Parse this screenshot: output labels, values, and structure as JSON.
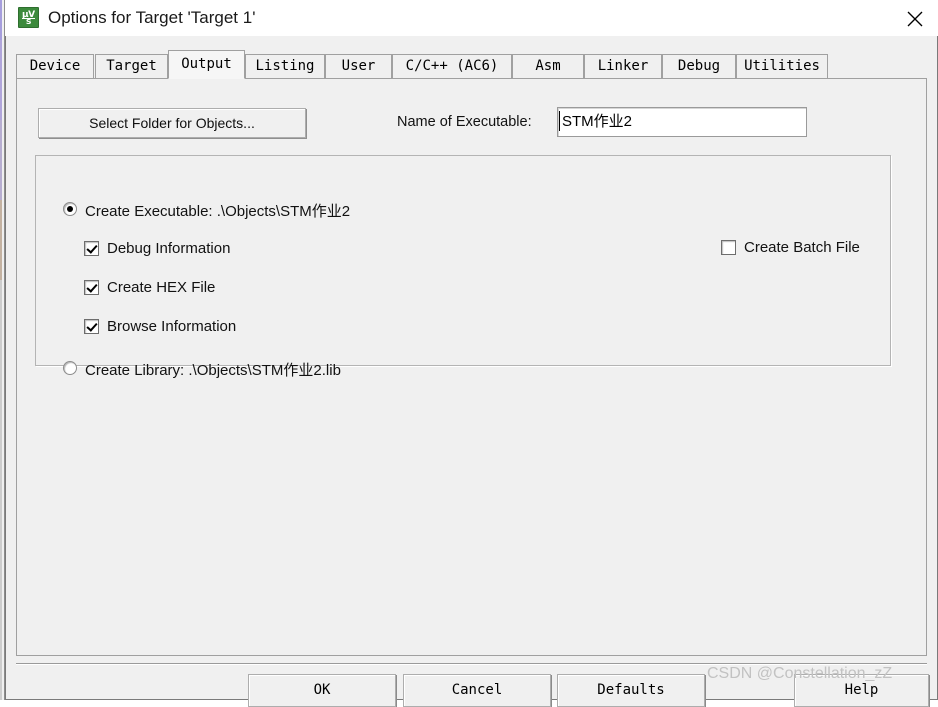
{
  "window": {
    "title": "Options for Target 'Target 1'",
    "icon": "uvision-logo-icon",
    "close_icon": "close-icon"
  },
  "tabs": [
    {
      "label": "Device",
      "active": false
    },
    {
      "label": "Target",
      "active": false
    },
    {
      "label": "Output",
      "active": true
    },
    {
      "label": "Listing",
      "active": false
    },
    {
      "label": "User",
      "active": false
    },
    {
      "label": "C/C++ (AC6)",
      "active": false
    },
    {
      "label": "Asm",
      "active": false
    },
    {
      "label": "Linker",
      "active": false
    },
    {
      "label": "Debug",
      "active": false
    },
    {
      "label": "Utilities",
      "active": false
    }
  ],
  "output_page": {
    "select_folder_button": "Select Folder for Objects...",
    "executable_name_label": "Name of Executable:",
    "executable_name_value": "STM作业2",
    "executable_name_placeholder": "",
    "create_executable": {
      "label": "Create Executable:  .\\Objects\\STM作业2",
      "checked": true
    },
    "debug_information": {
      "label": "Debug Information",
      "checked": true
    },
    "create_hex_file": {
      "label": "Create HEX File",
      "checked": true
    },
    "browse_information": {
      "label": "Browse Information",
      "checked": true
    },
    "create_library": {
      "label": "Create Library:  .\\Objects\\STM作业2.lib",
      "checked": false
    },
    "create_batch_file": {
      "label": "Create Batch File",
      "checked": false
    }
  },
  "buttons": {
    "ok": "OK",
    "cancel": "Cancel",
    "defaults": "Defaults",
    "help": "Help"
  },
  "watermark": "CSDN @Constellation_zZ",
  "colors": {
    "dialog_face": "#f0f0f0",
    "titlebar": "#ffffff",
    "text": "#121212",
    "icon_green": "#3c8a3c",
    "border": "#a0a0a0",
    "watermark": "#c2c2c2"
  }
}
